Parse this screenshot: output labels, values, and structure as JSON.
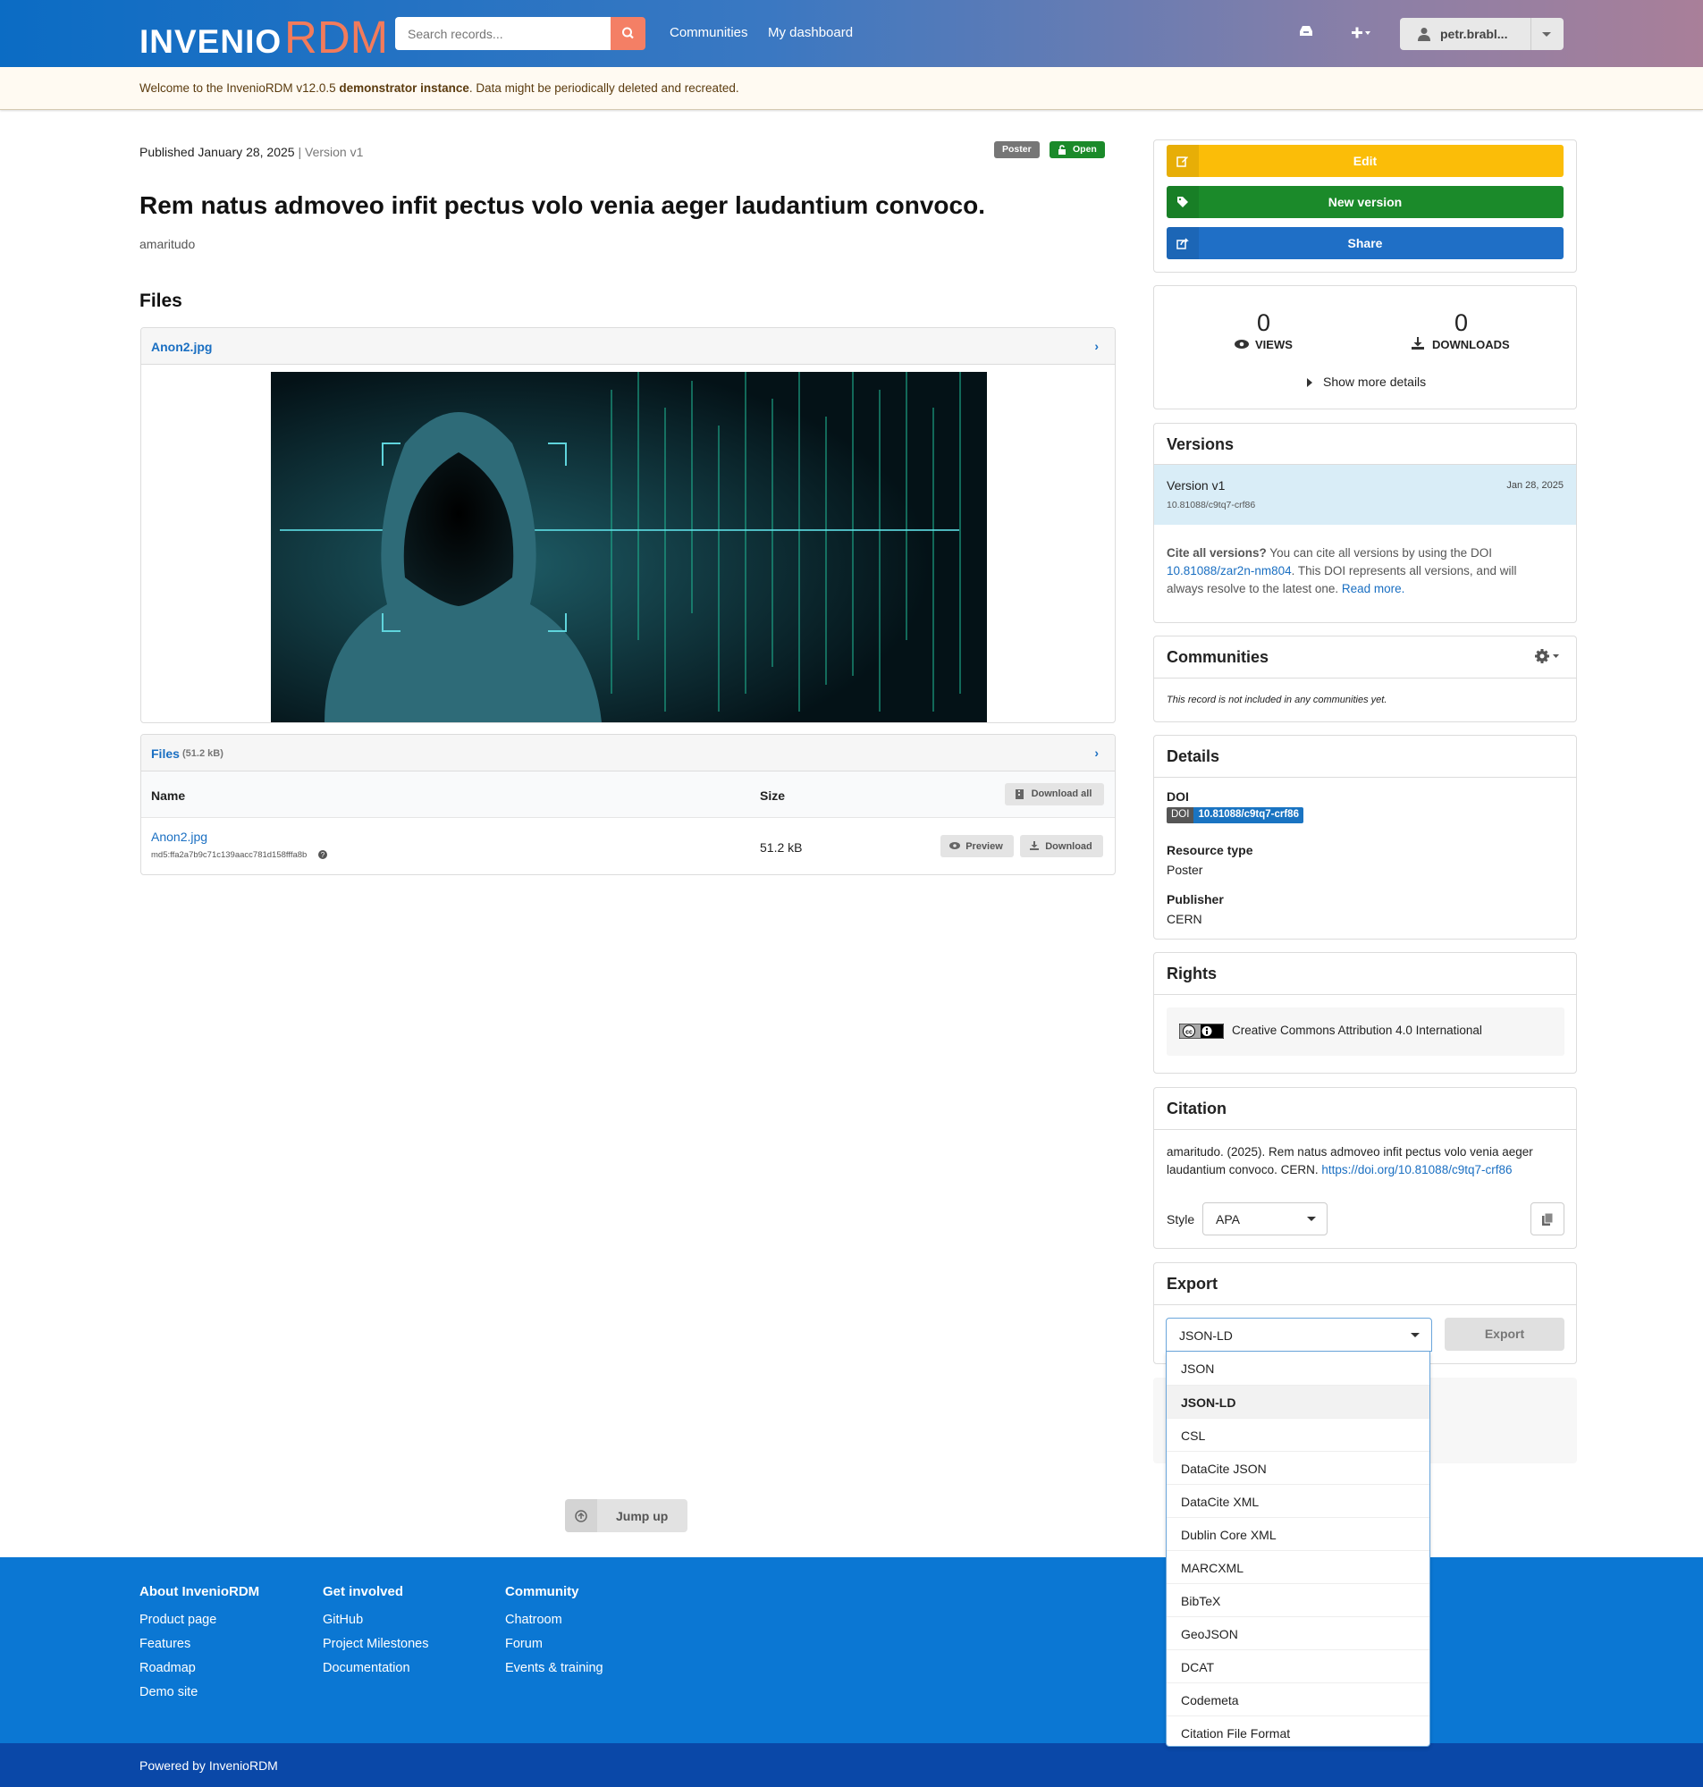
{
  "header": {
    "logo_part1": "INVENIO",
    "logo_part2": "RDM",
    "search_placeholder": "Search records...",
    "nav": [
      "Communities",
      "My dashboard"
    ],
    "user_name": "petr.brabl..."
  },
  "banner": {
    "prefix": "Welcome to the InvenioRDM v12.0.5 ",
    "bold": "demonstrator instance",
    "suffix": ". Data might be periodically deleted and recreated."
  },
  "record": {
    "published": "Published January 28, 2025",
    "separator": " | ",
    "version": "Version v1",
    "resource_label": "Poster",
    "access_label": "Open",
    "title": "Rem natus admoveo infit pectus volo venia aeger laudantium convoco.",
    "author": "amaritudo"
  },
  "files": {
    "heading": "Files",
    "preview_file": "Anon2.jpg",
    "list_title": "Files",
    "list_size": "(51.2 kB)",
    "col_name": "Name",
    "col_size": "Size",
    "download_all": "Download all",
    "rows": [
      {
        "name": "Anon2.jpg",
        "checksum": "md5:ffa2a7b9c71c139aacc781d158fffa8b",
        "size": "51.2 kB",
        "preview": "Preview",
        "download": "Download"
      }
    ]
  },
  "sidebar": {
    "edit": "Edit",
    "new_version": "New version",
    "share": "Share",
    "views_count": "0",
    "views_label": "VIEWS",
    "downloads_count": "0",
    "downloads_label": "DOWNLOADS",
    "show_more": "Show more details",
    "versions_title": "Versions",
    "version_name": "Version v1",
    "version_date": "Jan 28, 2025",
    "version_doi": "10.81088/c9tq7-crf86",
    "cite_bold": "Cite all versions?",
    "cite_text1": " You can cite all versions by using the DOI",
    "cite_doi": "10.81088/zar2n-nm804",
    "cite_text2": ". This DOI represents all versions, and will",
    "cite_text3": "always resolve to the latest one. ",
    "read_more": "Read more.",
    "communities_title": "Communities",
    "communities_empty": "This record is not included in any communities yet.",
    "details_title": "Details",
    "doi_label": "DOI",
    "doi_badge_left": "DOI",
    "doi_badge_right": "10.81088/c9tq7-crf86",
    "resource_type_label": "Resource type",
    "resource_type_value": "Poster",
    "publisher_label": "Publisher",
    "publisher_value": "CERN",
    "rights_title": "Rights",
    "license": "Creative Commons Attribution 4.0 International",
    "citation_title": "Citation",
    "citation_line1": "amaritudo. (2025). Rem natus admoveo infit pectus volo venia aeger",
    "citation_line2": "laudantium convoco. CERN. ",
    "citation_link": "https://doi.org/10.81088/c9tq7-crf86",
    "style_label": "Style",
    "style_value": "APA",
    "export_title": "Export",
    "export_selected": "JSON-LD",
    "export_button": "Export",
    "export_options": [
      "JSON",
      "JSON-LD",
      "CSL",
      "DataCite JSON",
      "DataCite XML",
      "Dublin Core XML",
      "MARCXML",
      "BibTeX",
      "GeoJSON",
      "DCAT",
      "Codemeta",
      "Citation File Format"
    ]
  },
  "jump_up": "Jump up",
  "footer": {
    "col1_title": "About InvenioRDM",
    "col1": [
      "Product page",
      "Features",
      "Roadmap",
      "Demo site"
    ],
    "col2_title": "Get involved",
    "col2": [
      "GitHub",
      "Project Milestones",
      "Documentation"
    ],
    "col3_title": "Community",
    "col3": [
      "Chatroom",
      "Forum",
      "Events & training"
    ],
    "powered": "Powered by InvenioRDM"
  },
  "colors": {
    "edit": "#fbbd08",
    "new_version": "#1b8a2a",
    "share": "#1f6fc6",
    "footer": "#0b77d3",
    "footer_bottom": "#0a48a8"
  }
}
